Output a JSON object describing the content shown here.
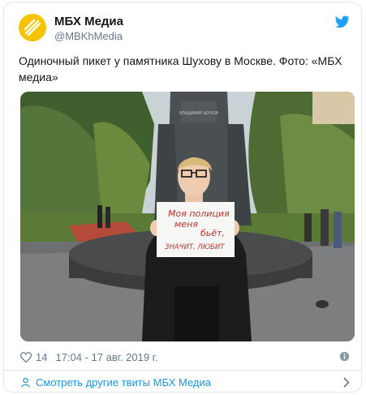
{
  "account": {
    "display_name": "МБХ Медиа",
    "handle": "@MBKhMedia",
    "avatar_icon": "mbh-media-logo",
    "avatar_color": "#f5c400"
  },
  "tweet": {
    "text": "Одиночный пикет у памятника Шухову в Москве. Фото: «МБХ медиа»",
    "photo": {
      "sign_lines": [
        "Моя полиция",
        "меня",
        "бьёт,",
        "ЗНАЧИТ, ЛЮБИТ"
      ],
      "monument_plaque": "ВЛАДИМИР ШУХОВ"
    }
  },
  "meta": {
    "likes": "14",
    "timestamp": "17:04 - 17 авг. 2019 г.",
    "like_icon": "heart-icon",
    "info_icon": "info-icon"
  },
  "footer": {
    "more_tweets_label": "Смотреть другие твиты МБХ Медиа"
  },
  "colors": {
    "brand_blue": "#1da1f2",
    "link_blue": "#1b95e0",
    "secondary_text": "#657786"
  }
}
